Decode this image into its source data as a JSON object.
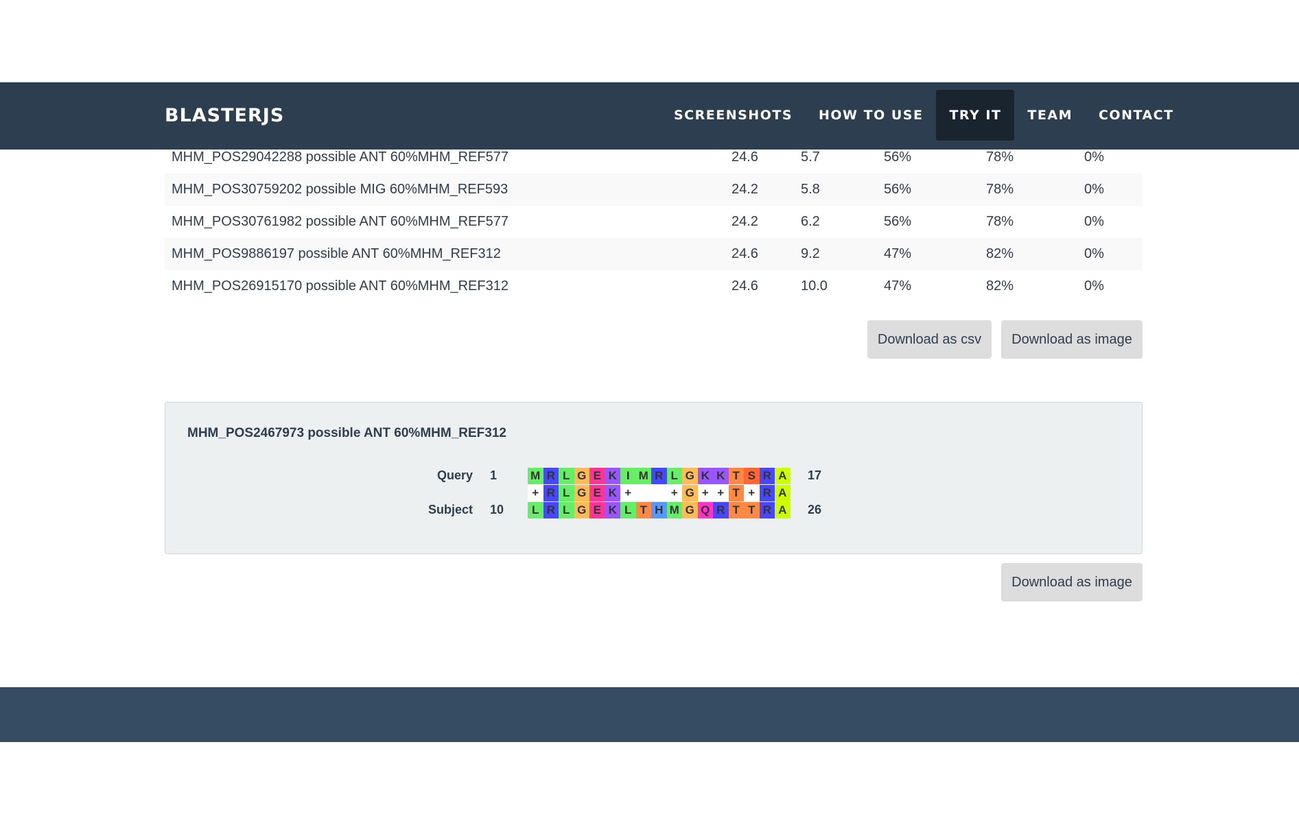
{
  "navbar": {
    "brand": "BLASTERJS",
    "items": [
      {
        "label": "SCREENSHOTS",
        "name": "nav-screenshots",
        "active": false
      },
      {
        "label": "HOW TO USE",
        "name": "nav-how-to-use",
        "active": false
      },
      {
        "label": "TRY IT",
        "name": "nav-try-it",
        "active": true
      },
      {
        "label": "TEAM",
        "name": "nav-team",
        "active": false
      },
      {
        "label": "CONTACT",
        "name": "nav-contact",
        "active": false
      }
    ]
  },
  "results": {
    "rows": [
      {
        "name": "MHM_POS29042288 possible ANT 60%MHM_REF577",
        "score": "24.6",
        "evalue": "5.7",
        "identities": "56%",
        "positives": "78%",
        "gaps": "0%"
      },
      {
        "name": "MHM_POS30759202 possible MIG 60%MHM_REF593",
        "score": "24.2",
        "evalue": "5.8",
        "identities": "56%",
        "positives": "78%",
        "gaps": "0%"
      },
      {
        "name": "MHM_POS30761982 possible ANT 60%MHM_REF577",
        "score": "24.2",
        "evalue": "6.2",
        "identities": "56%",
        "positives": "78%",
        "gaps": "0%"
      },
      {
        "name": "MHM_POS9886197 possible ANT 60%MHM_REF312",
        "score": "24.6",
        "evalue": "9.2",
        "identities": "47%",
        "positives": "82%",
        "gaps": "0%"
      },
      {
        "name": "MHM_POS26915170 possible ANT 60%MHM_REF312",
        "score": "24.6",
        "evalue": "10.0",
        "identities": "47%",
        "positives": "82%",
        "gaps": "0%"
      }
    ],
    "download_csv_label": "Download as csv",
    "download_image_label": "Download as image"
  },
  "alignment": {
    "title": "MHM_POS2467973 possible ANT 60%MHM_REF312",
    "query_label": "Query",
    "query_start": "1",
    "query_end": "17",
    "subject_label": "Subject",
    "subject_start": "10",
    "subject_end": "26",
    "query_seq": [
      "M",
      "R",
      "L",
      "G",
      "E",
      "K",
      "I",
      "M",
      "R",
      "L",
      "G",
      "K",
      "K",
      "T",
      "S",
      "R",
      "A"
    ],
    "match_seq": [
      "+",
      "R",
      "L",
      "G",
      "E",
      "K",
      "+",
      " ",
      " ",
      "+",
      "G",
      "+",
      "+",
      "T",
      "+",
      "R",
      "A"
    ],
    "subject_seq": [
      "L",
      "R",
      "L",
      "G",
      "E",
      "K",
      "L",
      "T",
      "H",
      "M",
      "G",
      "Q",
      "R",
      "T",
      "T",
      "R",
      "A"
    ],
    "residue_colors": {
      "A": "#ccff00",
      "R": "#4747ff",
      "L": "#66ee66",
      "G": "#ffbb55",
      "E": "#ff3399",
      "K": "#9955ff",
      "I": "#66ee66",
      "M": "#66ee66",
      "T": "#ff8844",
      "S": "#ff6633",
      "H": "#5599ff",
      "Q": "#ff33cc",
      "+": "#ffffff",
      " ": "#ffffff"
    },
    "download_image_label": "Download as image"
  }
}
